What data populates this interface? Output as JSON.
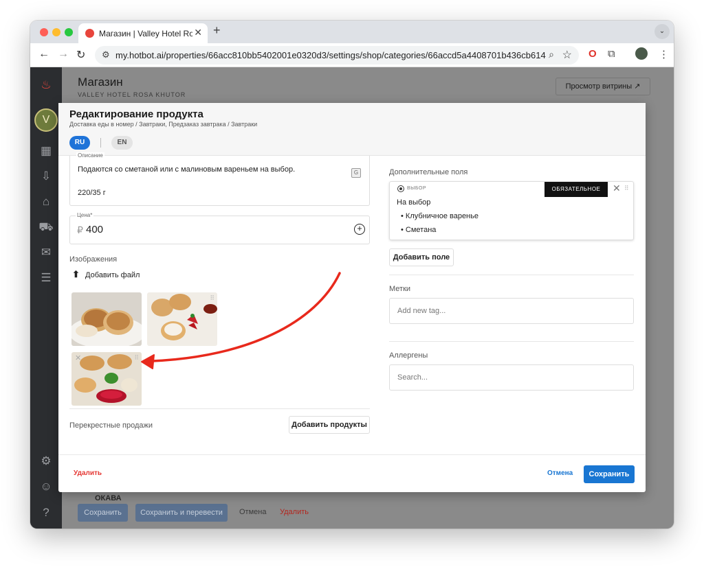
{
  "browser": {
    "tab_title": "Магазин | Valley Hotel Rosa Khutor",
    "url": "my.hotbot.ai/properties/66acc810bb5402001e0320d3/settings/shop/categories/66accd5a4408701b436cb614",
    "new_tab": "+",
    "close_tab": "✕",
    "tab_menu": "⌄"
  },
  "background": {
    "title": "Магазин",
    "subtitle": "VALLEY HOTEL ROSA KHUTOR",
    "preview_button": "Просмотр витрины ↗",
    "partial_text": "ОКАВА",
    "save": "Сохранить",
    "save_translate": "Сохранить и перевести",
    "cancel": "Отмена",
    "delete": "Удалить"
  },
  "modal": {
    "title": "Редактирование продукта",
    "breadcrumb": "Доставка еды в номер / Завтраки,     Предзаказ завтрака / Завтраки",
    "lang_ru": "RU",
    "lang_en": "EN",
    "description_label": "Описание",
    "description_line1": "Подаются со сметаной или с малиновым вареньем на выбор.",
    "description_line2": "220/35 г",
    "price_label": "Цена*",
    "currency": "₽",
    "price_value": "400",
    "images_label": "Изображения",
    "add_file": "Добавить файл",
    "cross_sales_label": "Перекрестные продажи",
    "add_products": "Добавить продукты",
    "extra_fields_label": "Дополнительные поля",
    "choice_type": "ВЫБОР",
    "required_badge": "ОБЯЗАТЕЛЬНОЕ ПОЛЕ",
    "choice_title": "На выбор",
    "options": [
      "Клубничное варенье",
      "Сметана"
    ],
    "add_field": "Добавить поле",
    "tags_label": "Метки",
    "tags_placeholder": "Add new tag...",
    "allergens_label": "Аллергены",
    "allergens_placeholder": "Search...",
    "delete": "Удалить",
    "cancel": "Отмена",
    "save": "Сохранить"
  },
  "colors": {
    "accent": "#1976d2",
    "danger": "#e53935",
    "annotation_arrow": "#e8291c"
  }
}
